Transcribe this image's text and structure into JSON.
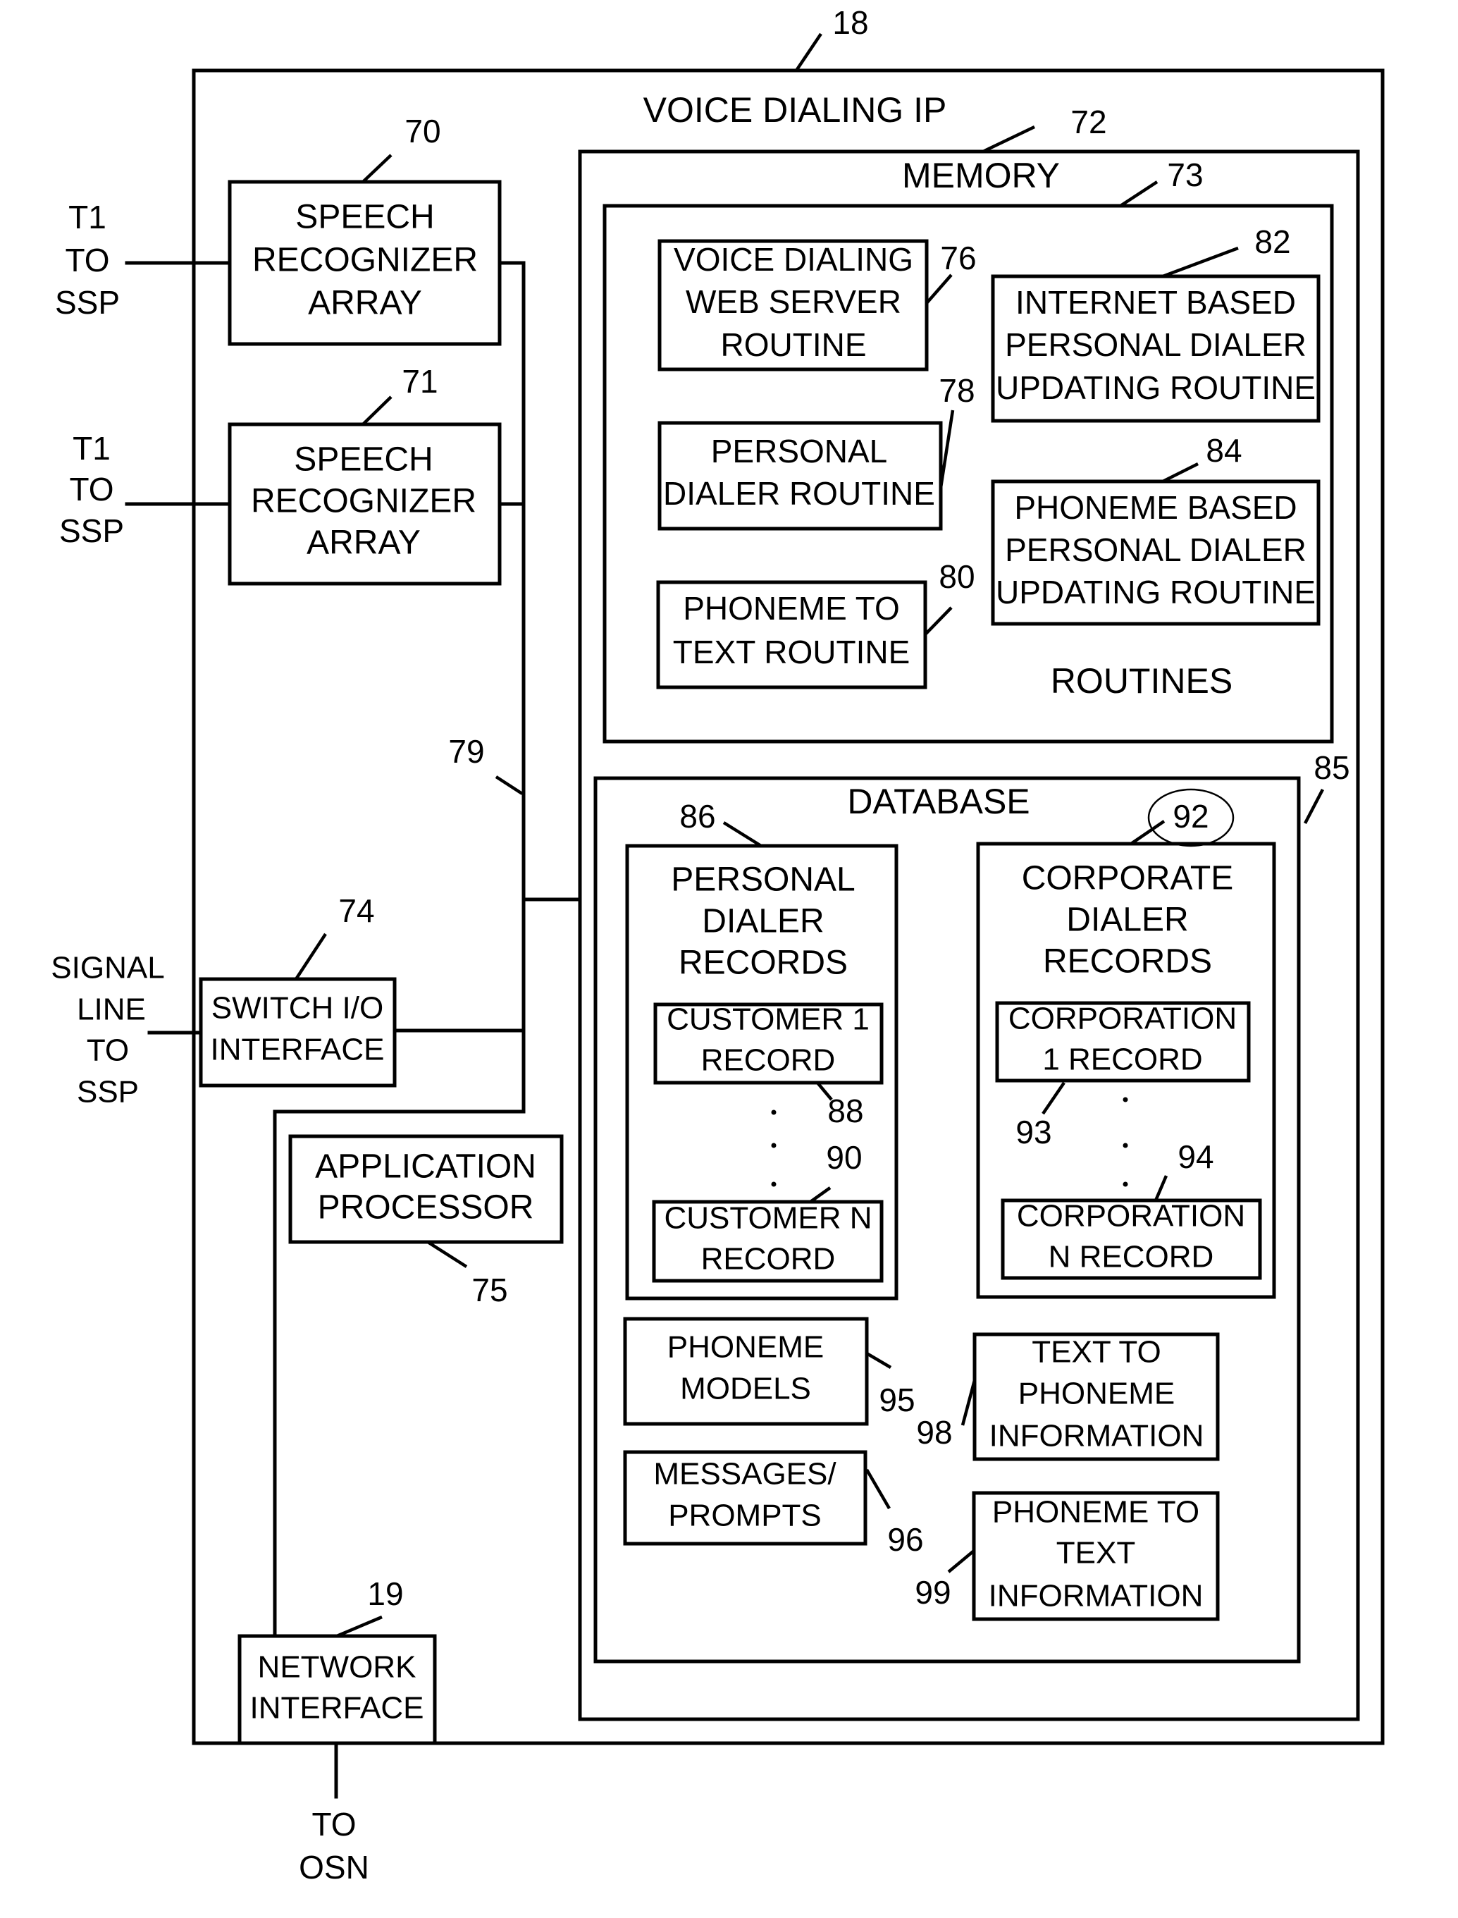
{
  "figure": {
    "ref": "18",
    "title": "VOICE DIALING IP"
  },
  "external": {
    "t1_top": [
      "T1",
      "TO",
      "SSP"
    ],
    "t1_bottom": [
      "T1",
      "TO",
      "SSP"
    ],
    "signal_line": [
      "SIGNAL",
      "LINE",
      "TO",
      "SSP"
    ],
    "to_osn": [
      "TO",
      "OSN"
    ]
  },
  "components": {
    "speech_recognizer_1": {
      "ref": "70",
      "lines": [
        "SPEECH",
        "RECOGNIZER",
        "ARRAY"
      ]
    },
    "speech_recognizer_2": {
      "ref": "71",
      "lines": [
        "SPEECH",
        "RECOGNIZER",
        "ARRAY"
      ]
    },
    "bus": {
      "ref": "79"
    },
    "switch_io": {
      "ref": "74",
      "lines": [
        "SWITCH I/O",
        "INTERFACE"
      ]
    },
    "app_processor": {
      "ref": "75",
      "lines": [
        "APPLICATION",
        "PROCESSOR"
      ]
    },
    "network_interface": {
      "ref": "19",
      "lines": [
        "NETWORK",
        "INTERFACE"
      ]
    }
  },
  "memory": {
    "ref": "72",
    "label": "MEMORY",
    "routines": {
      "ref": "73",
      "label": "ROUTINES",
      "items": [
        {
          "ref": "76",
          "lines": [
            "VOICE DIALING",
            "WEB SERVER",
            "ROUTINE"
          ]
        },
        {
          "ref": "78",
          "lines": [
            "PERSONAL",
            "DIALER ROUTINE"
          ]
        },
        {
          "ref": "80",
          "lines": [
            "PHONEME TO",
            "TEXT ROUTINE"
          ]
        },
        {
          "ref": "82",
          "lines": [
            "INTERNET BASED",
            "PERSONAL DIALER",
            "UPDATING ROUTINE"
          ]
        },
        {
          "ref": "84",
          "lines": [
            "PHONEME BASED",
            "PERSONAL DIALER",
            "UPDATING ROUTINE"
          ]
        }
      ]
    },
    "database": {
      "ref": "85",
      "label": "DATABASE",
      "personal_records": {
        "ref": "86",
        "lines": [
          "PERSONAL",
          "DIALER",
          "RECORDS"
        ],
        "first": {
          "ref": "88",
          "lines": [
            "CUSTOMER 1",
            "RECORD"
          ]
        },
        "last": {
          "ref": "90",
          "lines": [
            "CUSTOMER N",
            "RECORD"
          ]
        }
      },
      "corporate_records": {
        "ref": "92",
        "lines": [
          "CORPORATE",
          "DIALER",
          "RECORDS"
        ],
        "first": {
          "ref": "93",
          "lines": [
            "CORPORATION",
            "1 RECORD"
          ]
        },
        "last": {
          "ref": "94",
          "lines": [
            "CORPORATION",
            "N RECORD"
          ]
        }
      },
      "phoneme_models": {
        "ref": "95",
        "lines": [
          "PHONEME",
          "MODELS"
        ]
      },
      "messages_prompts": {
        "ref": "96",
        "lines": [
          "MESSAGES/",
          "PROMPTS"
        ]
      },
      "text_to_phoneme": {
        "ref": "98",
        "lines": [
          "TEXT TO",
          "PHONEME",
          "INFORMATION"
        ]
      },
      "phoneme_to_text": {
        "ref": "99",
        "lines": [
          "PHONEME TO",
          "TEXT",
          "INFORMATION"
        ]
      }
    }
  }
}
